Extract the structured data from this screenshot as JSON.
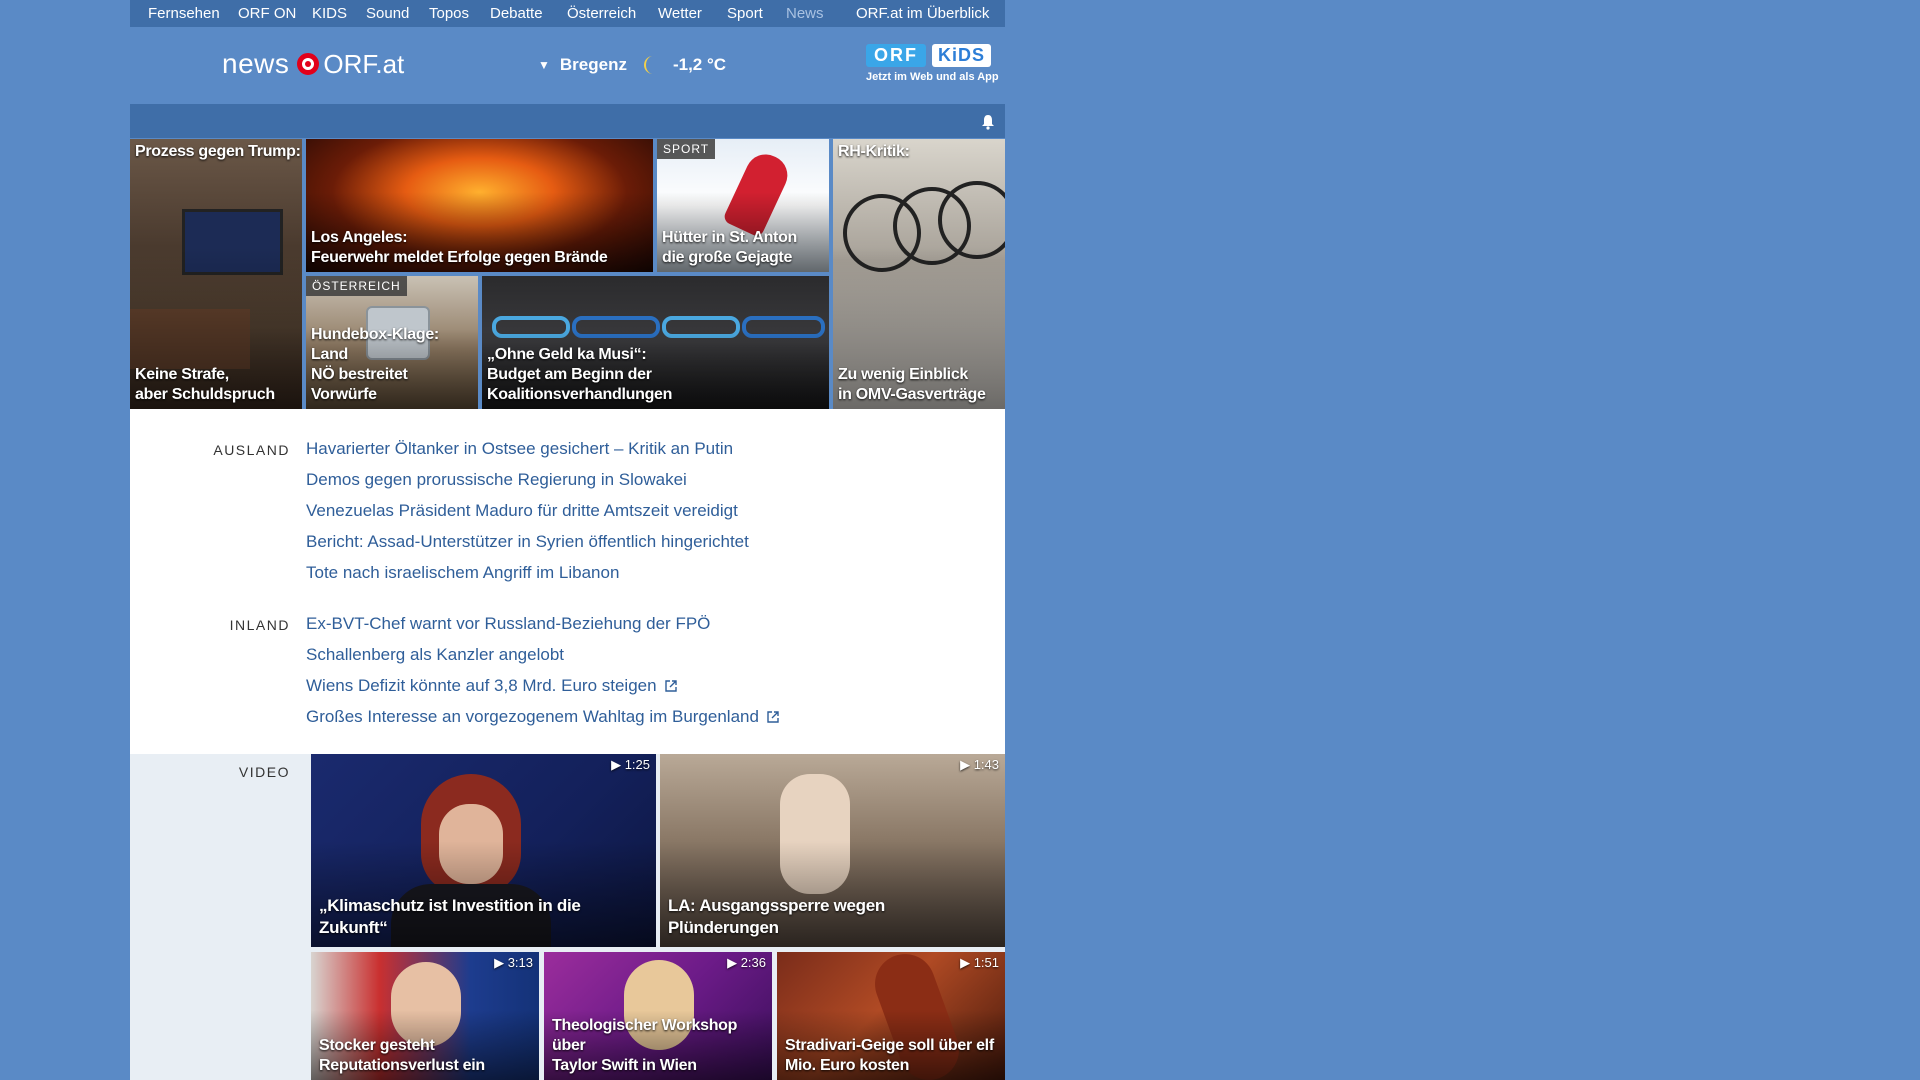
{
  "topnav": {
    "items": [
      "Fernsehen",
      "ORF ON",
      "KIDS",
      "Sound",
      "Topos",
      "Debatte",
      "Österreich",
      "Wetter",
      "Sport",
      "News",
      "ORF.at im Überblick"
    ],
    "active": "News"
  },
  "header": {
    "logo_news": "news",
    "logo_orf": "ORF.at",
    "weather": {
      "location": "Bregenz",
      "temperature": "-1,2 °C",
      "icon": "moon-icon"
    },
    "kids_promo": {
      "orf": "ORF",
      "kids": "KiDS",
      "subtitle": "Jetzt im Web und als App"
    }
  },
  "teasers": [
    {
      "top": "Prozess gegen Trump:",
      "title": "Keine Strafe,\naber Schuldspruch"
    },
    {
      "title": "Los Angeles:\nFeuerwehr meldet Erfolge gegen Brände"
    },
    {
      "tag": "SPORT",
      "title": "Hütter in St. Anton\ndie große Gejagte"
    },
    {
      "top": "RH-Kritik:",
      "title": "Zu wenig Einblick\nin OMV-Gasverträge"
    },
    {
      "tag": "ÖSTERREICH",
      "title": "Hundebox-Klage: Land\nNÖ bestreitet Vorwürfe"
    },
    {
      "title": "„Ohne Geld ka Musi“:\nBudget am Beginn der Koalitionsverhandlungen"
    }
  ],
  "sections": {
    "ausland": {
      "label": "AUSLAND",
      "links": [
        "Havarierter Öltanker in Ostsee gesichert – Kritik an Putin",
        "Demos gegen prorussische Regierung in Slowakei",
        "Venezuelas Präsident Maduro für dritte Amtszeit vereidigt",
        "Bericht: Assad-Unterstützer in Syrien öffentlich hingerichtet",
        "Tote nach israelischem Angriff im Libanon"
      ]
    },
    "inland": {
      "label": "INLAND",
      "links": [
        "Ex-BVT-Chef warnt vor Russland-Beziehung der FPÖ",
        "Schallenberg als Kanzler angelobt",
        "Wiens Defizit könnte auf 3,8 Mrd. Euro steigen",
        "Großes Interesse an vorgezogenem Wahltag im Burgenland"
      ]
    }
  },
  "video": {
    "label": "VIDEO",
    "items": [
      {
        "duration": "▶ 1:25",
        "title": "„Klimaschutz ist Investition in die Zukunft“"
      },
      {
        "duration": "▶ 1:43",
        "title": "LA: Ausgangssperre wegen Plünderungen"
      },
      {
        "duration": "▶ 3:13",
        "title": "Stocker gesteht\nReputationsverlust ein"
      },
      {
        "duration": "▶ 2:36",
        "title": "Theologischer Workshop über\nTaylor Swift in Wien"
      },
      {
        "duration": "▶ 1:51",
        "title": "Stradivari-Geige soll über elf\nMio. Euro kosten"
      }
    ]
  },
  "colors": {
    "background": "#5a8ac6",
    "nav": "#3f6ea8",
    "link": "#2f5e99",
    "orf_red": "#e2001a"
  }
}
